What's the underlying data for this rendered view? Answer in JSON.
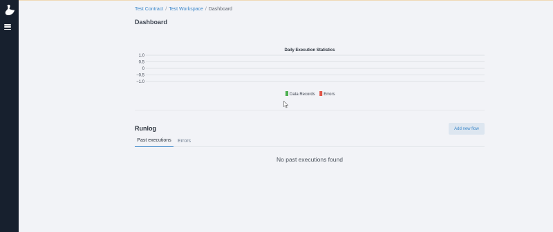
{
  "breadcrumb": {
    "items": [
      "Test Contract",
      "Test Workspace"
    ],
    "current": "Dashboard",
    "separator": "/"
  },
  "page": {
    "title": "Dashboard"
  },
  "chart_data": {
    "type": "bar",
    "title": "Daily Execution Statistics",
    "yticks": [
      "1.0",
      "0.5",
      "0",
      "−0.5",
      "−1.0"
    ],
    "ylim": [
      -1.0,
      1.0
    ],
    "categories": [],
    "series": [
      {
        "name": "Data Records",
        "color": "#4caf50",
        "values": []
      },
      {
        "name": "Errors",
        "color": "#e05548",
        "values": []
      }
    ],
    "grid": true,
    "legend": "bottom-center"
  },
  "runlog": {
    "title": "Runlog",
    "add_button": "Add new flow",
    "tabs": [
      {
        "label": "Past executions",
        "active": true
      },
      {
        "label": "Errors",
        "active": false
      }
    ],
    "empty_message": "No past executions found"
  },
  "colors": {
    "sidebar_bg": "#17202e",
    "page_bg": "#f2f3f7",
    "link": "#3b87c9"
  },
  "icons": {
    "logo": "goose-logo-icon",
    "menu": "hamburger-menu-icon",
    "cursor": "mouse-pointer-icon"
  }
}
